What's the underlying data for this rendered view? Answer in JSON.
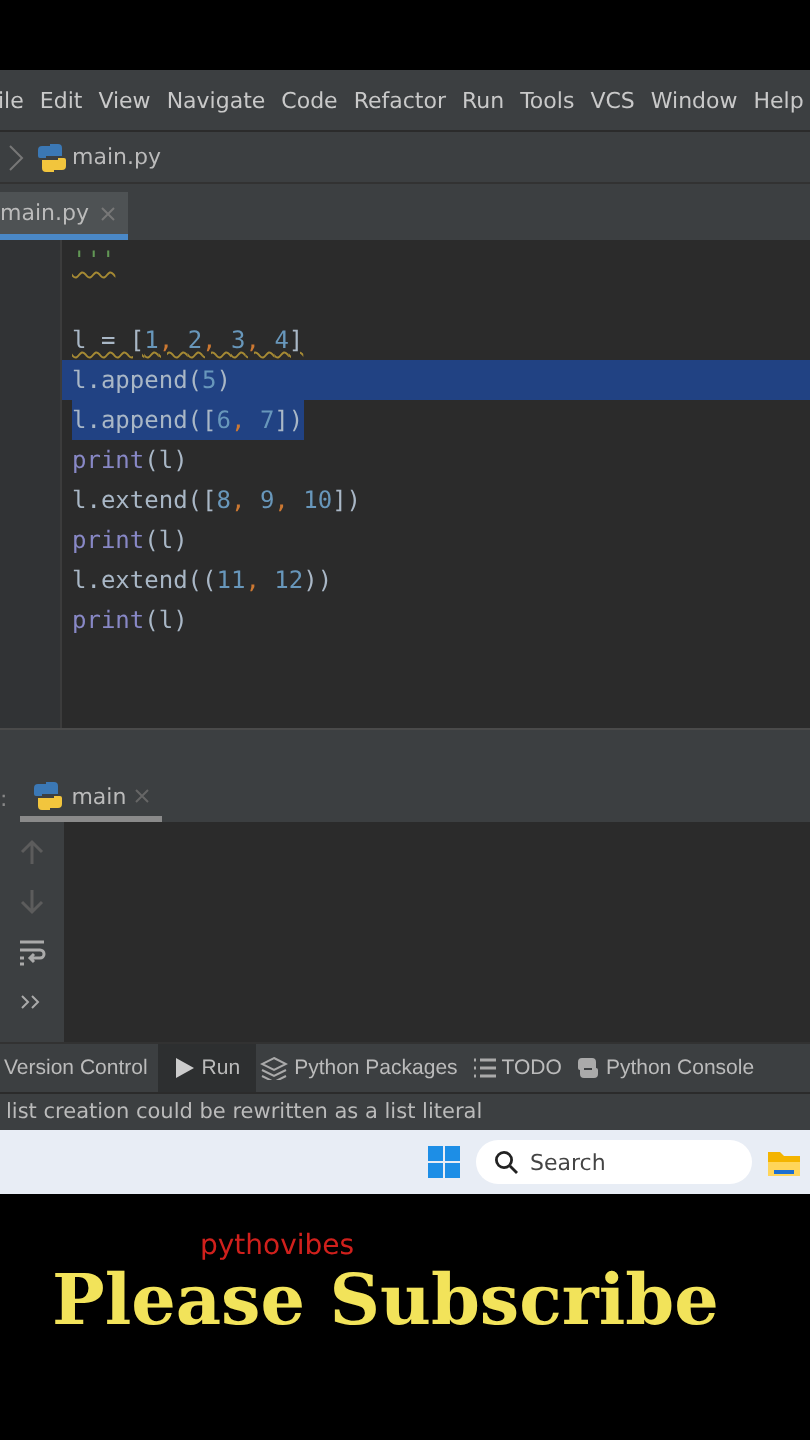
{
  "menu_bar": [
    "ile",
    "Edit",
    "View",
    "Navigate",
    "Code",
    "Refactor",
    "Run",
    "Tools",
    "VCS",
    "Window",
    "Help"
  ],
  "breadcrumb": {
    "file": "main.py"
  },
  "editor_tabs": [
    {
      "label": "main.py",
      "selected": true
    }
  ],
  "code_lines": [
    {
      "kind": "code",
      "selected": false,
      "warning": true,
      "tokens": [
        {
          "kind": "doc",
          "text": "'''"
        }
      ]
    },
    {
      "kind": "blank"
    },
    {
      "kind": "code",
      "selected": false,
      "warning": true,
      "tokens": [
        {
          "kind": "plain",
          "text": "l = ["
        },
        {
          "kind": "number",
          "text": "1"
        },
        {
          "kind": "comma",
          "text": ", "
        },
        {
          "kind": "number",
          "text": "2"
        },
        {
          "kind": "comma",
          "text": ", "
        },
        {
          "kind": "number",
          "text": "3"
        },
        {
          "kind": "comma",
          "text": ", "
        },
        {
          "kind": "number",
          "text": "4"
        },
        {
          "kind": "plain",
          "text": "]"
        }
      ]
    },
    {
      "kind": "code",
      "selected": true,
      "warning": false,
      "tokens": [
        {
          "kind": "plain",
          "text": "l.append("
        },
        {
          "kind": "number",
          "text": "5"
        },
        {
          "kind": "plain",
          "text": ")"
        }
      ]
    },
    {
      "kind": "code",
      "selected": true,
      "warning": false,
      "tokens": [
        {
          "kind": "plain",
          "text": "l.append(["
        },
        {
          "kind": "number",
          "text": "6"
        },
        {
          "kind": "comma",
          "text": ", "
        },
        {
          "kind": "number",
          "text": "7"
        },
        {
          "kind": "plain",
          "text": "])"
        }
      ]
    },
    {
      "kind": "code",
      "selected": false,
      "warning": false,
      "tokens": [
        {
          "kind": "builtin",
          "text": "print"
        },
        {
          "kind": "plain",
          "text": "(l)"
        }
      ]
    },
    {
      "kind": "code",
      "selected": false,
      "warning": false,
      "tokens": [
        {
          "kind": "plain",
          "text": "l.extend(["
        },
        {
          "kind": "number",
          "text": "8"
        },
        {
          "kind": "comma",
          "text": ", "
        },
        {
          "kind": "number",
          "text": "9"
        },
        {
          "kind": "comma",
          "text": ", "
        },
        {
          "kind": "number",
          "text": "10"
        },
        {
          "kind": "plain",
          "text": "])"
        }
      ]
    },
    {
      "kind": "code",
      "selected": false,
      "warning": false,
      "tokens": [
        {
          "kind": "builtin",
          "text": "print"
        },
        {
          "kind": "plain",
          "text": "(l)"
        }
      ]
    },
    {
      "kind": "code",
      "selected": false,
      "warning": false,
      "tokens": [
        {
          "kind": "plain",
          "text": "l.extend(("
        },
        {
          "kind": "number",
          "text": "11"
        },
        {
          "kind": "comma",
          "text": ", "
        },
        {
          "kind": "number",
          "text": "12"
        },
        {
          "kind": "plain",
          "text": "))"
        }
      ]
    },
    {
      "kind": "code",
      "selected": false,
      "warning": false,
      "tokens": [
        {
          "kind": "builtin",
          "text": "print"
        },
        {
          "kind": "plain",
          "text": "(l)"
        }
      ]
    }
  ],
  "run_panel": {
    "label": ":",
    "tabs": [
      {
        "label": "main",
        "selected": true
      }
    ],
    "toolbar": [
      {
        "kind": "up",
        "disabled": true
      },
      {
        "kind": "down",
        "disabled": true
      },
      {
        "kind": "wrap",
        "disabled": false
      },
      {
        "kind": "more",
        "disabled": false
      }
    ]
  },
  "tool_tabs": [
    {
      "label": "Version Control",
      "kind": "none",
      "selected": false
    },
    {
      "label": "Run",
      "kind": "run",
      "selected": true
    },
    {
      "label": "Python Packages",
      "kind": "packages",
      "selected": false
    },
    {
      "label": "TODO",
      "kind": "todo",
      "selected": false
    },
    {
      "label": "Python Console",
      "kind": "console",
      "selected": false
    }
  ],
  "status_bar": "list creation could be rewritten as a list literal",
  "taskbar": {
    "search": {
      "placeholder": "Search"
    }
  },
  "banner": {
    "channel": "pythovibes",
    "caption": "Please Subscribe"
  }
}
